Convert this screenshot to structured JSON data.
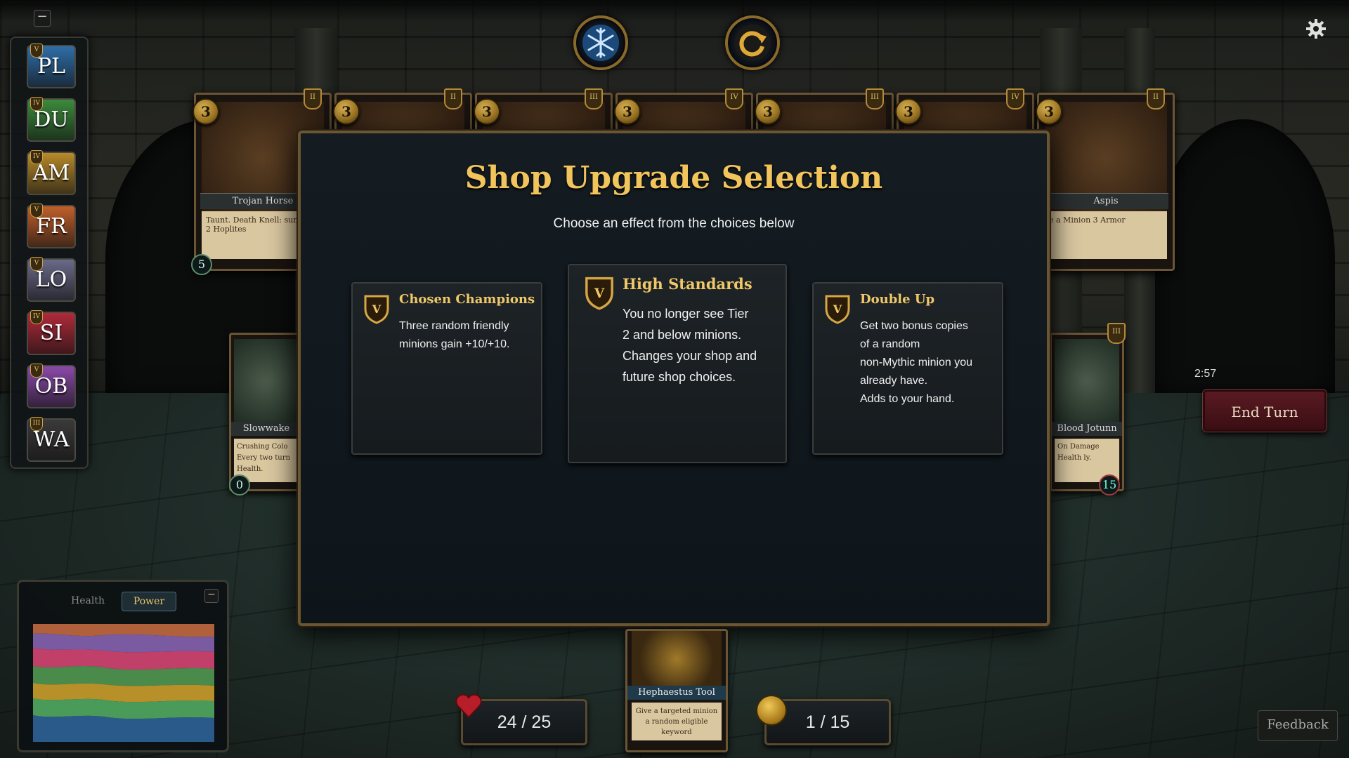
{
  "modal": {
    "title": "Shop Upgrade Selection",
    "subtitle": "Choose an effect from the choices below",
    "choices": [
      {
        "tier": "V",
        "title": "Chosen Champions",
        "description": "Three random friendly\nminions gain +10/+10."
      },
      {
        "tier": "V",
        "title": "High Standards",
        "description": "You no longer see Tier\n2 and below minions.\nChanges your shop and\nfuture shop choices."
      },
      {
        "tier": "V",
        "title": "Double Up",
        "description": "Get two bonus copies\nof a random\nnon-Mythic minion you\nalready have.\nAdds to your hand."
      }
    ]
  },
  "tribes": [
    {
      "abbr": "PL",
      "tier": "V",
      "color": "#2f6ea8"
    },
    {
      "abbr": "DU",
      "tier": "IV",
      "color": "#3c8a3c"
    },
    {
      "abbr": "AM",
      "tier": "IV",
      "color": "#b88a2a"
    },
    {
      "abbr": "FR",
      "tier": "V",
      "color": "#c0602a"
    },
    {
      "abbr": "LO",
      "tier": "V",
      "color": "#6a6a8a"
    },
    {
      "abbr": "SI",
      "tier": "IV",
      "color": "#b02a3a"
    },
    {
      "abbr": "OB",
      "tier": "V",
      "color": "#8a4aa8"
    },
    {
      "abbr": "WA",
      "tier": "III",
      "color": "#3a3a3a"
    }
  ],
  "shop_cards": [
    {
      "cost": "3",
      "tier": "II",
      "name": "Trojan Horse",
      "description": "Taunt. Death Knell: summon 2 Hoplites",
      "stat": "5"
    },
    {
      "cost": "3",
      "tier": "II",
      "name": "",
      "description": "",
      "stat": ""
    },
    {
      "cost": "3",
      "tier": "III",
      "name": "",
      "description": "",
      "stat": ""
    },
    {
      "cost": "3",
      "tier": "IV",
      "name": "",
      "description": "",
      "stat": ""
    },
    {
      "cost": "3",
      "tier": "III",
      "name": "",
      "description": "",
      "stat": ""
    },
    {
      "cost": "3",
      "tier": "IV",
      "name": "",
      "description": "",
      "stat": ""
    },
    {
      "cost": "3",
      "tier": "II",
      "name": "Aspis",
      "description": "e a Minion 3 Armor",
      "stat": ""
    }
  ],
  "board": {
    "left_card": {
      "name": "Slowwake",
      "description": "Crushing Colo Every two turn Health.",
      "stat": "0"
    },
    "right_card": {
      "name": "Blood Jotunn",
      "tier": "III",
      "description": "On Damage Health ly.",
      "stat": "15"
    }
  },
  "controls": {
    "freeze_icon": "snowflake-icon",
    "refresh_icon": "refresh-icon",
    "end_turn_label": "End Turn",
    "timer": "2:57",
    "feedback_label": "Feedback",
    "settings_icon": "gear-icon"
  },
  "player": {
    "health": "24 / 25",
    "gold": "1 / 15"
  },
  "hand": [
    {
      "name": "Hephaestus Tool",
      "description": "Give a targeted minion a random eligible keyword"
    }
  ],
  "graph": {
    "tabs": [
      "Health",
      "Power"
    ],
    "active_tab": "Power"
  }
}
